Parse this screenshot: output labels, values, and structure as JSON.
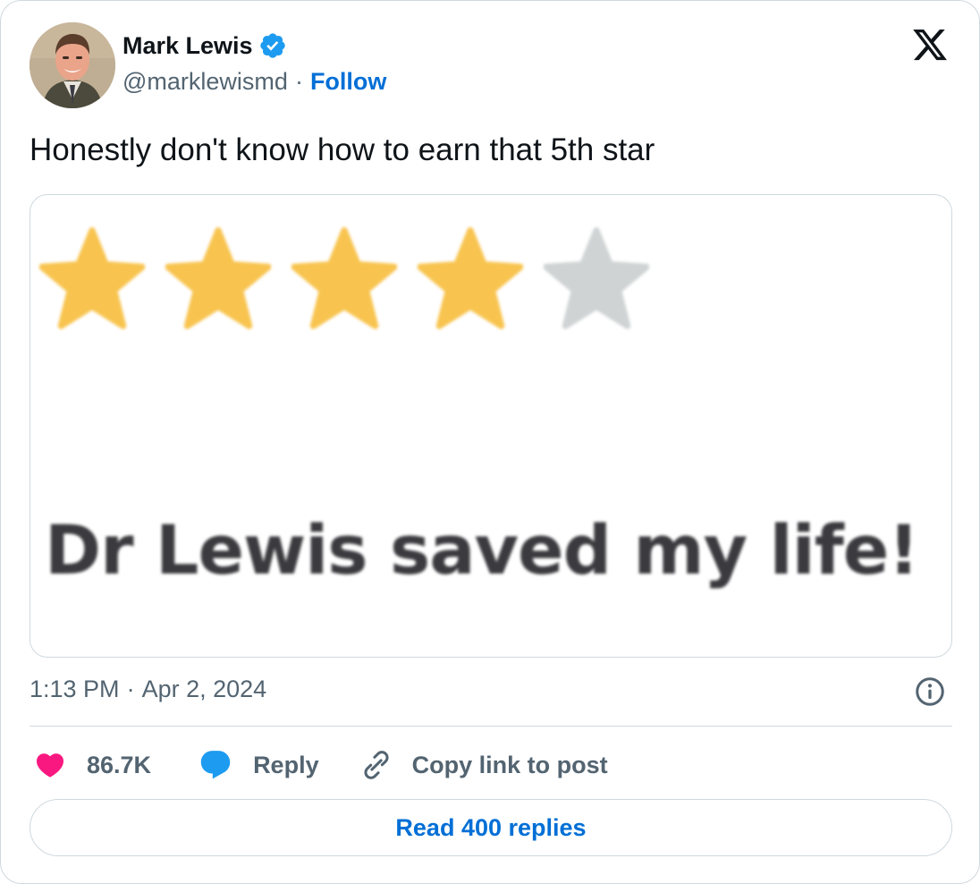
{
  "author": {
    "name": "Mark Lewis",
    "handle": "@marklewismd",
    "separator": "·",
    "follow_label": "Follow",
    "verified": true
  },
  "tweet": {
    "text": "Honestly don't know how to earn that 5th star"
  },
  "media": {
    "rating": {
      "filled": 4,
      "max": 5
    },
    "review_text": "Dr Lewis saved my life!",
    "colors": {
      "filled_star": "#f8c44f",
      "empty_star": "#cfd3d4",
      "text": "#3b3b3f"
    }
  },
  "meta": {
    "time": "1:13 PM",
    "separator": "·",
    "date": "Apr 2, 2024"
  },
  "actions": {
    "likes": "86.7K",
    "reply_label": "Reply",
    "copy_label": "Copy link to post"
  },
  "read_replies_label": "Read 400 replies",
  "icons": {
    "platform": "x-logo-icon",
    "verified": "verified-badge-icon",
    "info": "info-icon",
    "like": "heart-icon",
    "reply": "speech-bubble-icon",
    "copy": "link-icon"
  },
  "colors": {
    "text": "#0f1419",
    "secondary": "#536471",
    "link": "#006fd6",
    "like": "#f91880",
    "reply": "#1d9bf0",
    "border": "#cfd9de"
  }
}
